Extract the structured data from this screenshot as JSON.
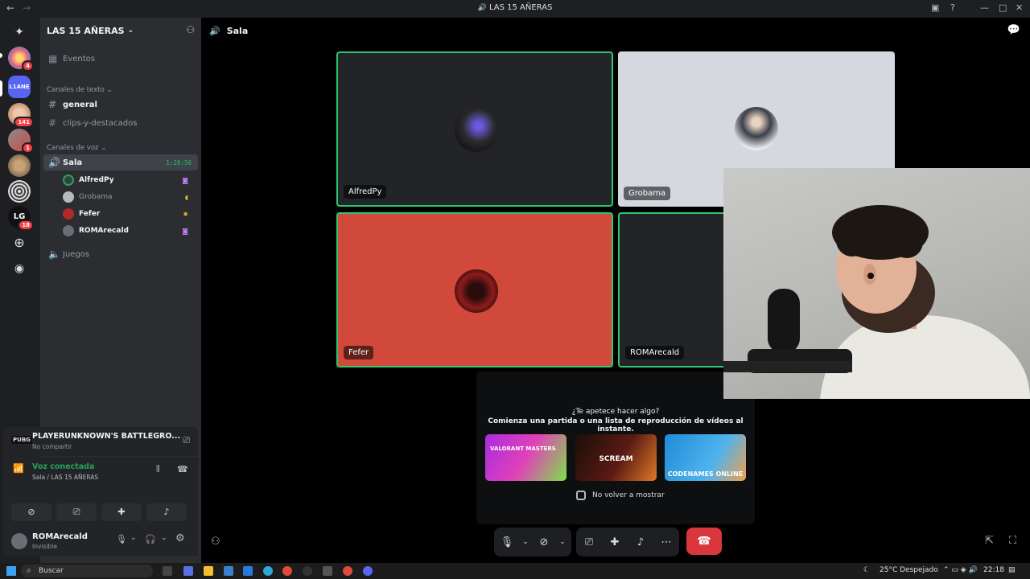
{
  "titlebar": {
    "back": "←",
    "forward": "→",
    "title": "LAS 15 AÑERAS"
  },
  "rail": {
    "badges": [
      "4",
      "141",
      "1",
      "18"
    ]
  },
  "sidebar": {
    "guild_name": "LAS 15 AÑERAS",
    "events_label": "Eventos",
    "text_category": "Canales de texto",
    "text_channels": [
      "general",
      "clips-y-destacados"
    ],
    "voice_category": "Canales de voz",
    "voice_channel": "Sala",
    "voice_timer": "1:28:56",
    "voice_users": [
      "AlfredPy",
      "Grobama",
      "Fefer",
      "ROMArecald"
    ],
    "other_voice_channel": "Juegos"
  },
  "game_panel": {
    "game_title": "PLAYERUNKNOWN'S BATTLEGRO...",
    "subtitle": "No compartir"
  },
  "voice_panel": {
    "status": "Voz conectada",
    "location": "Sala / LAS 15 AÑERAS"
  },
  "user_panel": {
    "username": "ROMArecald",
    "status": "Invisible"
  },
  "stage": {
    "channel_name": "Sala",
    "tiles": [
      {
        "name": "AlfredPy"
      },
      {
        "name": "Grobama"
      },
      {
        "name": "Fefer"
      },
      {
        "name": "ROMArecald"
      }
    ],
    "activity": {
      "question": "¿Te apetece hacer algo?",
      "prompt": "Comienza una partida o una lista de reproducción de vídeos al instante.",
      "cards": [
        "VALORANT MASTERS",
        "SCREAM",
        "CODENAMES ONLINE"
      ],
      "dont_show": "No volver a mostrar"
    }
  },
  "taskbar": {
    "search_placeholder": "Buscar",
    "weather": "25°C  Despejado",
    "time": "22:18"
  },
  "colors": {
    "accent_green": "#23a55a",
    "speaking_border": "#2dc770",
    "hangup": "#da373c",
    "fefer_tile": "#d0493a"
  }
}
